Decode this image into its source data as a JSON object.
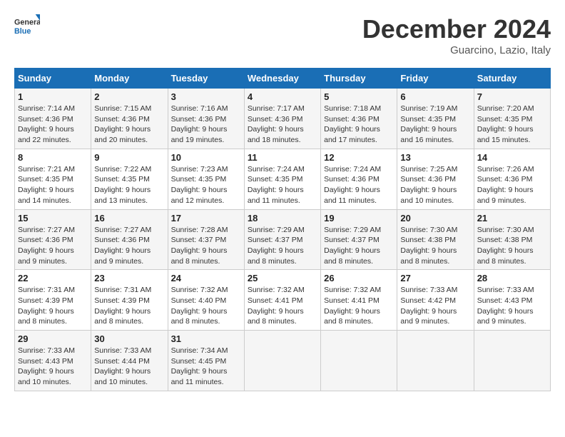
{
  "header": {
    "logo_line1": "General",
    "logo_line2": "Blue",
    "month": "December 2024",
    "location": "Guarcino, Lazio, Italy"
  },
  "weekdays": [
    "Sunday",
    "Monday",
    "Tuesday",
    "Wednesday",
    "Thursday",
    "Friday",
    "Saturday"
  ],
  "weeks": [
    [
      {
        "day": "1",
        "sunrise": "7:14 AM",
        "sunset": "4:36 PM",
        "daylight": "9 hours and 22 minutes."
      },
      {
        "day": "2",
        "sunrise": "7:15 AM",
        "sunset": "4:36 PM",
        "daylight": "9 hours and 20 minutes."
      },
      {
        "day": "3",
        "sunrise": "7:16 AM",
        "sunset": "4:36 PM",
        "daylight": "9 hours and 19 minutes."
      },
      {
        "day": "4",
        "sunrise": "7:17 AM",
        "sunset": "4:36 PM",
        "daylight": "9 hours and 18 minutes."
      },
      {
        "day": "5",
        "sunrise": "7:18 AM",
        "sunset": "4:36 PM",
        "daylight": "9 hours and 17 minutes."
      },
      {
        "day": "6",
        "sunrise": "7:19 AM",
        "sunset": "4:35 PM",
        "daylight": "9 hours and 16 minutes."
      },
      {
        "day": "7",
        "sunrise": "7:20 AM",
        "sunset": "4:35 PM",
        "daylight": "9 hours and 15 minutes."
      }
    ],
    [
      {
        "day": "8",
        "sunrise": "7:21 AM",
        "sunset": "4:35 PM",
        "daylight": "9 hours and 14 minutes."
      },
      {
        "day": "9",
        "sunrise": "7:22 AM",
        "sunset": "4:35 PM",
        "daylight": "9 hours and 13 minutes."
      },
      {
        "day": "10",
        "sunrise": "7:23 AM",
        "sunset": "4:35 PM",
        "daylight": "9 hours and 12 minutes."
      },
      {
        "day": "11",
        "sunrise": "7:24 AM",
        "sunset": "4:35 PM",
        "daylight": "9 hours and 11 minutes."
      },
      {
        "day": "12",
        "sunrise": "7:24 AM",
        "sunset": "4:36 PM",
        "daylight": "9 hours and 11 minutes."
      },
      {
        "day": "13",
        "sunrise": "7:25 AM",
        "sunset": "4:36 PM",
        "daylight": "9 hours and 10 minutes."
      },
      {
        "day": "14",
        "sunrise": "7:26 AM",
        "sunset": "4:36 PM",
        "daylight": "9 hours and 9 minutes."
      }
    ],
    [
      {
        "day": "15",
        "sunrise": "7:27 AM",
        "sunset": "4:36 PM",
        "daylight": "9 hours and 9 minutes."
      },
      {
        "day": "16",
        "sunrise": "7:27 AM",
        "sunset": "4:36 PM",
        "daylight": "9 hours and 9 minutes."
      },
      {
        "day": "17",
        "sunrise": "7:28 AM",
        "sunset": "4:37 PM",
        "daylight": "9 hours and 8 minutes."
      },
      {
        "day": "18",
        "sunrise": "7:29 AM",
        "sunset": "4:37 PM",
        "daylight": "9 hours and 8 minutes."
      },
      {
        "day": "19",
        "sunrise": "7:29 AM",
        "sunset": "4:37 PM",
        "daylight": "9 hours and 8 minutes."
      },
      {
        "day": "20",
        "sunrise": "7:30 AM",
        "sunset": "4:38 PM",
        "daylight": "9 hours and 8 minutes."
      },
      {
        "day": "21",
        "sunrise": "7:30 AM",
        "sunset": "4:38 PM",
        "daylight": "9 hours and 8 minutes."
      }
    ],
    [
      {
        "day": "22",
        "sunrise": "7:31 AM",
        "sunset": "4:39 PM",
        "daylight": "9 hours and 8 minutes."
      },
      {
        "day": "23",
        "sunrise": "7:31 AM",
        "sunset": "4:39 PM",
        "daylight": "9 hours and 8 minutes."
      },
      {
        "day": "24",
        "sunrise": "7:32 AM",
        "sunset": "4:40 PM",
        "daylight": "9 hours and 8 minutes."
      },
      {
        "day": "25",
        "sunrise": "7:32 AM",
        "sunset": "4:41 PM",
        "daylight": "9 hours and 8 minutes."
      },
      {
        "day": "26",
        "sunrise": "7:32 AM",
        "sunset": "4:41 PM",
        "daylight": "9 hours and 8 minutes."
      },
      {
        "day": "27",
        "sunrise": "7:33 AM",
        "sunset": "4:42 PM",
        "daylight": "9 hours and 9 minutes."
      },
      {
        "day": "28",
        "sunrise": "7:33 AM",
        "sunset": "4:43 PM",
        "daylight": "9 hours and 9 minutes."
      }
    ],
    [
      {
        "day": "29",
        "sunrise": "7:33 AM",
        "sunset": "4:43 PM",
        "daylight": "9 hours and 10 minutes."
      },
      {
        "day": "30",
        "sunrise": "7:33 AM",
        "sunset": "4:44 PM",
        "daylight": "9 hours and 10 minutes."
      },
      {
        "day": "31",
        "sunrise": "7:34 AM",
        "sunset": "4:45 PM",
        "daylight": "9 hours and 11 minutes."
      },
      null,
      null,
      null,
      null
    ]
  ]
}
